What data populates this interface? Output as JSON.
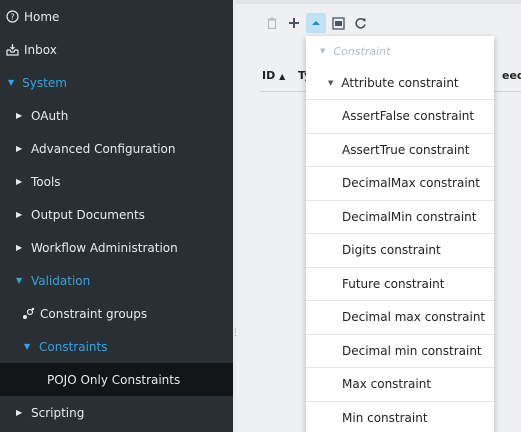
{
  "sidebar": {
    "items": [
      {
        "label": "Home",
        "icon": "help-circle-icon"
      },
      {
        "label": "Inbox",
        "icon": "inbox-icon"
      },
      {
        "label": "System"
      },
      {
        "label": "OAuth"
      },
      {
        "label": "Advanced Configuration"
      },
      {
        "label": "Tools"
      },
      {
        "label": "Output Documents"
      },
      {
        "label": "Workflow Administration"
      },
      {
        "label": "Validation"
      },
      {
        "label": "Constraint groups",
        "icon": "constraint-groups-icon"
      },
      {
        "label": "Constraints"
      },
      {
        "label": "POJO Only Constraints"
      },
      {
        "label": "Scripting"
      }
    ]
  },
  "toolbar": {
    "buttons": [
      "trash-icon",
      "plus-icon",
      "caret-up-icon",
      "csv-export-icon",
      "refresh-icon"
    ]
  },
  "grid": {
    "columns": [
      "ID",
      "Ty",
      "eeds"
    ]
  },
  "dropdown": {
    "header": "Constraint",
    "group": "Attribute constraint",
    "items": [
      "AssertFalse constraint",
      "AssertTrue constraint",
      "DecimalMax constraint",
      "DecimalMin constraint",
      "Digits constraint",
      "Future constraint",
      "Decimal max constraint",
      "Decimal min constraint",
      "Max constraint",
      "Min constraint"
    ]
  },
  "colors": {
    "sidebar_bg": "#2a2f34",
    "accent": "#2ea6e6",
    "selected_bg": "#121517",
    "main_bg": "#eef0f2"
  }
}
